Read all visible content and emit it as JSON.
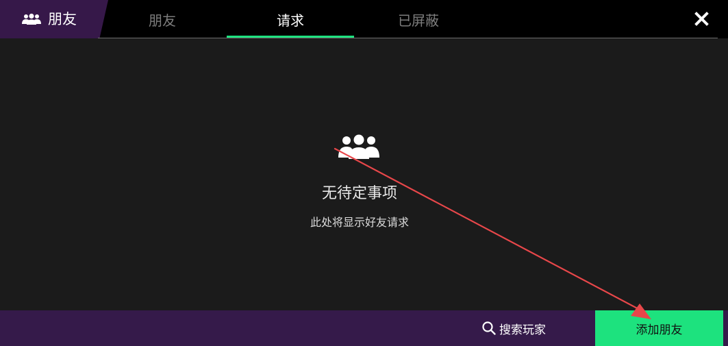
{
  "header": {
    "title": "朋友",
    "tabs": [
      {
        "label": "朋友",
        "active": false
      },
      {
        "label": "请求",
        "active": true
      },
      {
        "label": "已屏蔽",
        "active": false
      }
    ],
    "close_icon": "close-icon",
    "title_icon": "friends-icon"
  },
  "main": {
    "empty_icon": "friends-group-icon",
    "empty_title": "无待定事项",
    "empty_subtitle": "此处将显示好友请求"
  },
  "footer": {
    "search_label": "搜索玩家",
    "search_icon": "search-icon",
    "add_label": "添加朋友"
  },
  "colors": {
    "accent": "#1de27e",
    "brand_purple": "#361849",
    "panel_bg": "#1b1b1b",
    "annotation_arrow": "#e8474a"
  }
}
